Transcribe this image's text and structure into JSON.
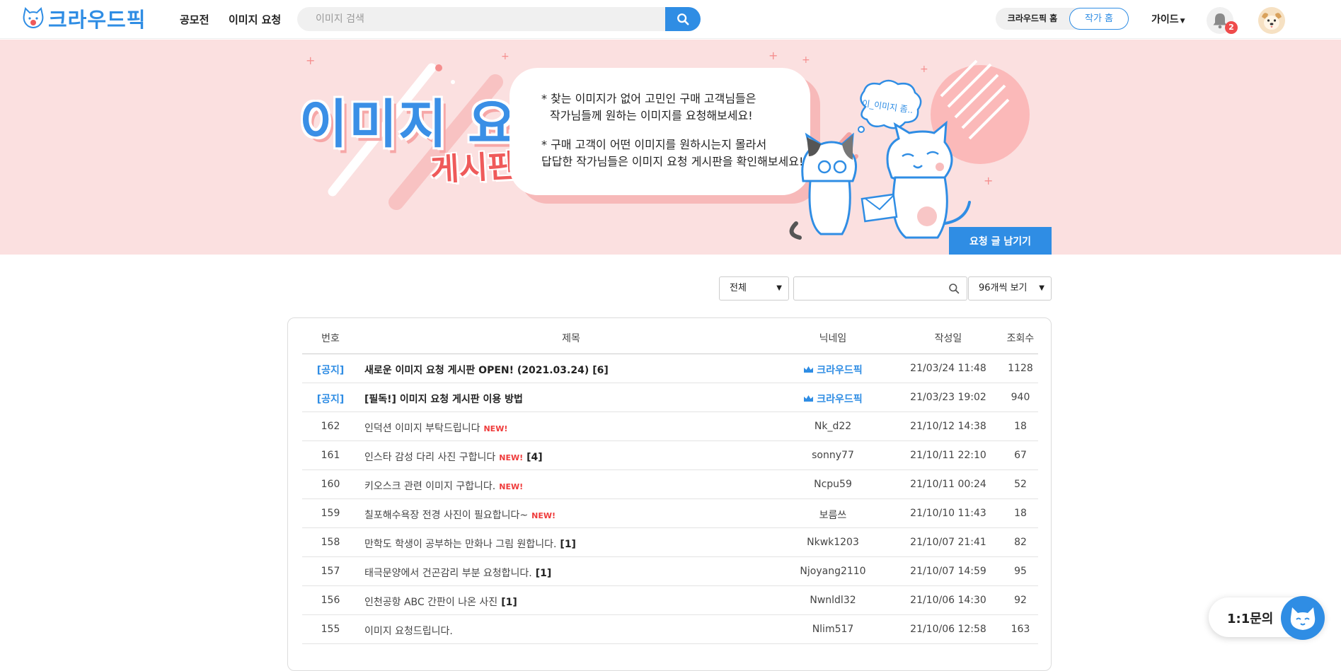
{
  "header": {
    "logo_text": "크라우드픽",
    "nav": [
      "공모전",
      "이미지 요청"
    ],
    "search_placeholder": "이미지 검색",
    "toggle_left": "크라우드픽 홈",
    "toggle_right": "작가 홈",
    "guide": "가이드",
    "notification_count": "2",
    "accent_color": "#2f8de4"
  },
  "banner": {
    "title_main": "이미지 요청",
    "title_sub": "게시판!",
    "desc": [
      "* 찾는 이미지가 없어 고민인 구매 고객님들은",
      "작가님들께 원하는 이미지를 요청해보세요!",
      "* 구매 고객이 어떤 이미지를 원하시는지 몰라서",
      "답답한 작가님들은 이미지 요청 게시판을 확인해보세요!"
    ],
    "bubble_text": "이_이미지 좀..",
    "request_button": "요청 글 남기기"
  },
  "filters": {
    "category": "전체",
    "page_size": "96개씩 보기"
  },
  "table": {
    "headers": [
      "번호",
      "제목",
      "닉네임",
      "작성일",
      "조회수"
    ],
    "new_label": "NEW!",
    "rows": [
      {
        "num": "[공지]",
        "title": "새로운 이미지 요청 게시판 OPEN! (2021.03.24)",
        "comments": "[6]",
        "new": "",
        "nick": "크라우드픽",
        "date": "21/03/24 11:48",
        "views": "1128",
        "notice": true
      },
      {
        "num": "[공지]",
        "title": "[필독!] 이미지 요청 게시판 이용 방법",
        "comments": "",
        "new": "",
        "nick": "크라우드픽",
        "date": "21/03/23 19:02",
        "views": "940",
        "notice": true
      },
      {
        "num": "162",
        "title": "인덕션 이미지 부탁드립니다",
        "comments": "",
        "new": "NEW!",
        "nick": "Nk_d22",
        "date": "21/10/12 14:38",
        "views": "18",
        "notice": false
      },
      {
        "num": "161",
        "title": "인스타 감성 다리 사진 구합니다",
        "comments": "[4]",
        "new": "NEW!",
        "nick": "sonny77",
        "date": "21/10/11 22:10",
        "views": "67",
        "notice": false
      },
      {
        "num": "160",
        "title": "키오스크 관련 이미지 구합니다.",
        "comments": "",
        "new": "NEW!",
        "nick": "Ncpu59",
        "date": "21/10/11 00:24",
        "views": "52",
        "notice": false
      },
      {
        "num": "159",
        "title": "칠포해수욕장 전경 사진이 필요합니다~",
        "comments": "",
        "new": "NEW!",
        "nick": "보름쓰",
        "date": "21/10/10 11:43",
        "views": "18",
        "notice": false
      },
      {
        "num": "158",
        "title": "만학도 학생이 공부하는 만화나 그림 원합니다.",
        "comments": "[1]",
        "new": "",
        "nick": "Nkwk1203",
        "date": "21/10/07 21:41",
        "views": "82",
        "notice": false
      },
      {
        "num": "157",
        "title": "태극문양에서 건곤감리 부분 요청합니다.",
        "comments": "[1]",
        "new": "",
        "nick": "Njoyang2110",
        "date": "21/10/07 14:59",
        "views": "95",
        "notice": false
      },
      {
        "num": "156",
        "title": "인천공항 ABC 간판이 나온 사진",
        "comments": "[1]",
        "new": "",
        "nick": "Nwnldl32",
        "date": "21/10/06 14:30",
        "views": "92",
        "notice": false
      },
      {
        "num": "155",
        "title": "이미지 요청드립니다.",
        "comments": "",
        "new": "",
        "nick": "Nlim517",
        "date": "21/10/06 12:58",
        "views": "163",
        "notice": false
      }
    ]
  },
  "chat": {
    "label": "1:1문의"
  }
}
